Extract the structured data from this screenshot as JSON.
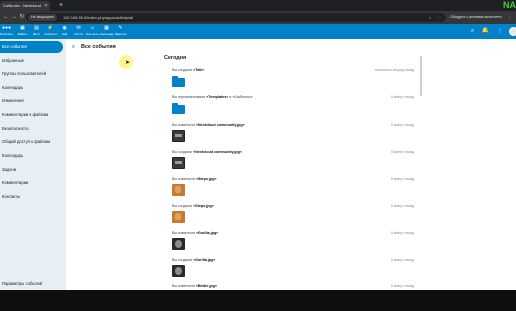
{
  "browser": {
    "tab_title": "События - Nextcloud",
    "tab_close": "✕",
    "new_tab": "+",
    "corner_logo": "NA",
    "back": "←",
    "forward": "→",
    "reload": "↻",
    "security_label": "Не защищено",
    "url": "192.168.50.8/index.php/apps/activity/all",
    "omni_icons": "☆ ⋯",
    "assistant_label": "Обсудить с речевым ассистентом",
    "extension_icon": "⋮"
  },
  "header": {
    "brand_color": "#0082c9",
    "apps": [
      {
        "icon": "●●●",
        "label": "Nextcloud"
      },
      {
        "icon": "▣",
        "label": "Файлы"
      },
      {
        "icon": "▤",
        "label": "Фото"
      },
      {
        "icon": "⚡",
        "label": "События"
      },
      {
        "icon": "◉",
        "label": "Talk"
      },
      {
        "icon": "✉",
        "label": "Почта"
      },
      {
        "icon": "☺",
        "label": "Контакты"
      },
      {
        "icon": "▦",
        "label": "Календарь"
      },
      {
        "icon": "✎",
        "label": "Заметки"
      }
    ],
    "search_icon": "⌕",
    "notifications_icon": "🔔",
    "contacts_icon": "👥"
  },
  "sidebar": {
    "items": [
      {
        "label": "Все события",
        "active": true
      },
      {
        "label": "Избранные"
      },
      {
        "label": "Группы пользователей"
      },
      {
        "label": "Календарь"
      },
      {
        "label": "Изменения"
      },
      {
        "label": "Комментарии к файлам"
      },
      {
        "label": "Безопасность"
      },
      {
        "label": "Общий доступ к файлам"
      },
      {
        "label": "Календарь"
      },
      {
        "label": "Задачи"
      },
      {
        "label": "Комментарии"
      },
      {
        "label": "Контакты"
      }
    ],
    "settings_label": "Параметры событий"
  },
  "main": {
    "filter_icon": "≡",
    "title": "Все события",
    "section": "Сегодня",
    "activities": [
      {
        "prefix": "Вы создали ",
        "subject": "«Talk»",
        "suffix": "",
        "time": "несколько секунд назад",
        "thumb": "folder"
      },
      {
        "prefix": "Вы переименовали ",
        "subject": "«Templates»",
        "suffix": " в «Шаблоны»",
        "time": "5 минут назад",
        "thumb": "folder"
      },
      {
        "prefix": "Вы изменили ",
        "subject": "«Nextcloud community.jpg»",
        "suffix": "",
        "time": "5 минут назад",
        "thumb": "screen"
      },
      {
        "prefix": "Вы создали ",
        "subject": "«Nextcloud community.jpg»",
        "suffix": "",
        "time": "5 минут назад",
        "thumb": "screen"
      },
      {
        "prefix": "Вы изменили ",
        "subject": "«Steps.jpg»",
        "suffix": "",
        "time": "5 минут назад",
        "thumb": "steps"
      },
      {
        "prefix": "Вы создали ",
        "subject": "«Steps.jpg»",
        "suffix": "",
        "time": "5 минут назад",
        "thumb": "steps"
      },
      {
        "prefix": "Вы изменили ",
        "subject": "«Gorilla.jpg»",
        "suffix": "",
        "time": "5 минут назад",
        "thumb": "gorilla"
      },
      {
        "prefix": "Вы создали ",
        "subject": "«Gorilla.jpg»",
        "suffix": "",
        "time": "5 минут назад",
        "thumb": "gorilla"
      },
      {
        "prefix": "Вы изменили ",
        "subject": "«Birdie.jpg»",
        "suffix": "",
        "time": "5 минут назад",
        "thumb": "steps"
      }
    ]
  }
}
